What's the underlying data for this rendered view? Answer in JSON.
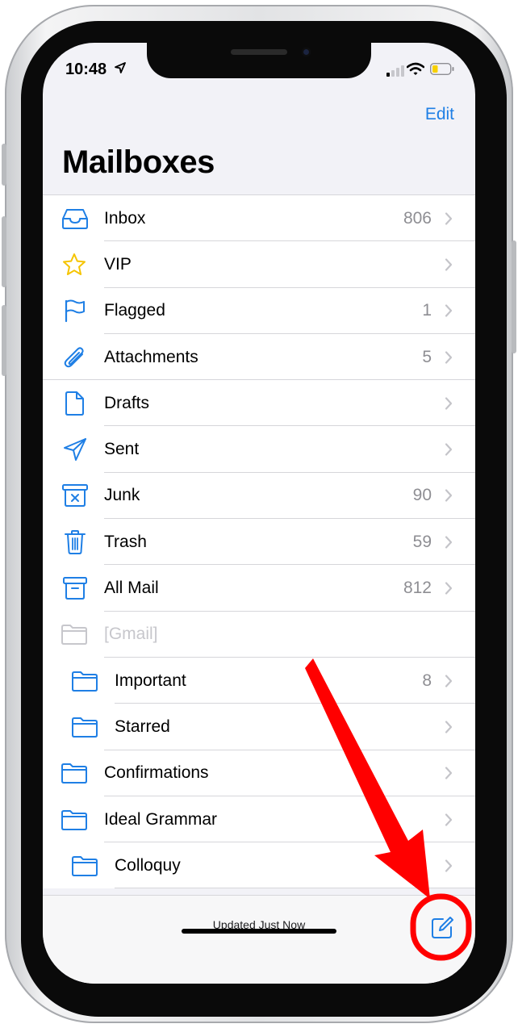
{
  "status_bar": {
    "time": "10:48"
  },
  "header": {
    "edit_label": "Edit",
    "title": "Mailboxes"
  },
  "mailboxes": [
    {
      "icon": "inbox-icon",
      "label": "Inbox",
      "count": "806"
    },
    {
      "icon": "star-icon",
      "label": "VIP",
      "count": ""
    },
    {
      "icon": "flag-icon",
      "label": "Flagged",
      "count": "1"
    },
    {
      "icon": "paperclip-icon",
      "label": "Attachments",
      "count": "5"
    },
    {
      "icon": "document-icon",
      "label": "Drafts",
      "count": ""
    },
    {
      "icon": "paper-plane-icon",
      "label": "Sent",
      "count": ""
    },
    {
      "icon": "junk-icon",
      "label": "Junk",
      "count": "90"
    },
    {
      "icon": "trash-icon",
      "label": "Trash",
      "count": "59"
    },
    {
      "icon": "archive-box-icon",
      "label": "All Mail",
      "count": "812"
    },
    {
      "icon": "folder-icon",
      "label": "[Gmail]",
      "count": ""
    },
    {
      "icon": "folder-icon",
      "label": "Important",
      "count": "8"
    },
    {
      "icon": "folder-icon",
      "label": "Starred",
      "count": ""
    },
    {
      "icon": "folder-icon",
      "label": "Confirmations",
      "count": ""
    },
    {
      "icon": "folder-icon",
      "label": "Ideal Grammar",
      "count": ""
    },
    {
      "icon": "folder-icon",
      "label": "Colloquy",
      "count": ""
    }
  ],
  "toolbar": {
    "status_text": "Updated Just Now",
    "compose_icon": "compose-icon"
  },
  "colors": {
    "accent": "#1f7fe5",
    "annotation": "#ff0000",
    "vip_star": "#f5c400"
  }
}
